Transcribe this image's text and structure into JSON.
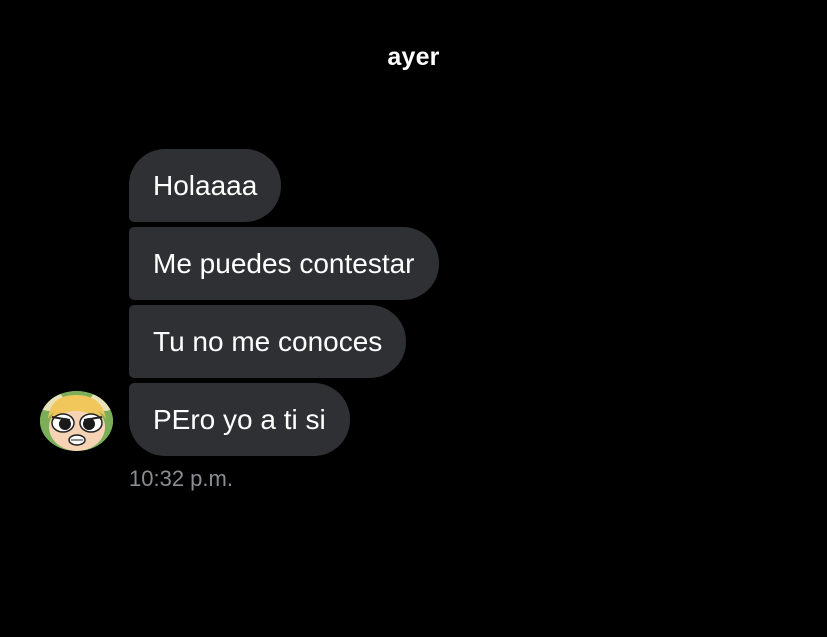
{
  "header": {
    "date_label": "ayer"
  },
  "messages": [
    {
      "text": "Holaaaa"
    },
    {
      "text": "Me puedes contestar"
    },
    {
      "text": "Tu no me conoces"
    },
    {
      "text": "PEro yo a ti si"
    }
  ],
  "footer": {
    "timestamp": "10:32 p.m."
  },
  "colors": {
    "background": "#000000",
    "bubble": "#2f3033",
    "text": "#ffffff",
    "timestamp": "#8a8d91"
  },
  "avatar": {
    "icon": "cartoon-girl-avatar-icon"
  }
}
